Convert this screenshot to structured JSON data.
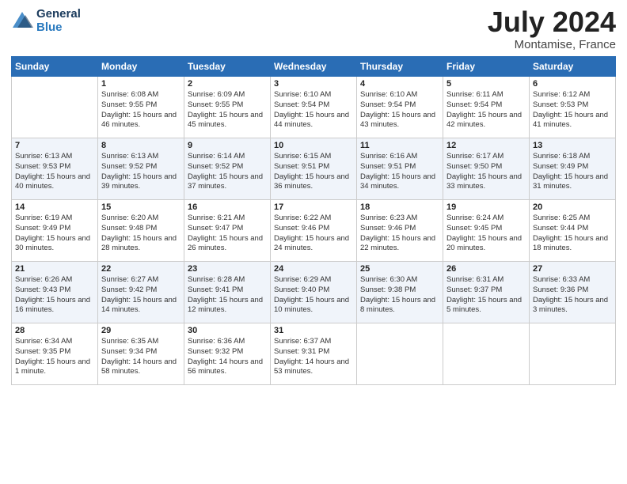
{
  "logo": {
    "line1": "General",
    "line2": "Blue"
  },
  "title": "July 2024",
  "subtitle": "Montamise, France",
  "header_days": [
    "Sunday",
    "Monday",
    "Tuesday",
    "Wednesday",
    "Thursday",
    "Friday",
    "Saturday"
  ],
  "weeks": [
    [
      {
        "day": "",
        "sunrise": "",
        "sunset": "",
        "daylight": ""
      },
      {
        "day": "1",
        "sunrise": "Sunrise: 6:08 AM",
        "sunset": "Sunset: 9:55 PM",
        "daylight": "Daylight: 15 hours and 46 minutes."
      },
      {
        "day": "2",
        "sunrise": "Sunrise: 6:09 AM",
        "sunset": "Sunset: 9:55 PM",
        "daylight": "Daylight: 15 hours and 45 minutes."
      },
      {
        "day": "3",
        "sunrise": "Sunrise: 6:10 AM",
        "sunset": "Sunset: 9:54 PM",
        "daylight": "Daylight: 15 hours and 44 minutes."
      },
      {
        "day": "4",
        "sunrise": "Sunrise: 6:10 AM",
        "sunset": "Sunset: 9:54 PM",
        "daylight": "Daylight: 15 hours and 43 minutes."
      },
      {
        "day": "5",
        "sunrise": "Sunrise: 6:11 AM",
        "sunset": "Sunset: 9:54 PM",
        "daylight": "Daylight: 15 hours and 42 minutes."
      },
      {
        "day": "6",
        "sunrise": "Sunrise: 6:12 AM",
        "sunset": "Sunset: 9:53 PM",
        "daylight": "Daylight: 15 hours and 41 minutes."
      }
    ],
    [
      {
        "day": "7",
        "sunrise": "Sunrise: 6:13 AM",
        "sunset": "Sunset: 9:53 PM",
        "daylight": "Daylight: 15 hours and 40 minutes."
      },
      {
        "day": "8",
        "sunrise": "Sunrise: 6:13 AM",
        "sunset": "Sunset: 9:52 PM",
        "daylight": "Daylight: 15 hours and 39 minutes."
      },
      {
        "day": "9",
        "sunrise": "Sunrise: 6:14 AM",
        "sunset": "Sunset: 9:52 PM",
        "daylight": "Daylight: 15 hours and 37 minutes."
      },
      {
        "day": "10",
        "sunrise": "Sunrise: 6:15 AM",
        "sunset": "Sunset: 9:51 PM",
        "daylight": "Daylight: 15 hours and 36 minutes."
      },
      {
        "day": "11",
        "sunrise": "Sunrise: 6:16 AM",
        "sunset": "Sunset: 9:51 PM",
        "daylight": "Daylight: 15 hours and 34 minutes."
      },
      {
        "day": "12",
        "sunrise": "Sunrise: 6:17 AM",
        "sunset": "Sunset: 9:50 PM",
        "daylight": "Daylight: 15 hours and 33 minutes."
      },
      {
        "day": "13",
        "sunrise": "Sunrise: 6:18 AM",
        "sunset": "Sunset: 9:49 PM",
        "daylight": "Daylight: 15 hours and 31 minutes."
      }
    ],
    [
      {
        "day": "14",
        "sunrise": "Sunrise: 6:19 AM",
        "sunset": "Sunset: 9:49 PM",
        "daylight": "Daylight: 15 hours and 30 minutes."
      },
      {
        "day": "15",
        "sunrise": "Sunrise: 6:20 AM",
        "sunset": "Sunset: 9:48 PM",
        "daylight": "Daylight: 15 hours and 28 minutes."
      },
      {
        "day": "16",
        "sunrise": "Sunrise: 6:21 AM",
        "sunset": "Sunset: 9:47 PM",
        "daylight": "Daylight: 15 hours and 26 minutes."
      },
      {
        "day": "17",
        "sunrise": "Sunrise: 6:22 AM",
        "sunset": "Sunset: 9:46 PM",
        "daylight": "Daylight: 15 hours and 24 minutes."
      },
      {
        "day": "18",
        "sunrise": "Sunrise: 6:23 AM",
        "sunset": "Sunset: 9:46 PM",
        "daylight": "Daylight: 15 hours and 22 minutes."
      },
      {
        "day": "19",
        "sunrise": "Sunrise: 6:24 AM",
        "sunset": "Sunset: 9:45 PM",
        "daylight": "Daylight: 15 hours and 20 minutes."
      },
      {
        "day": "20",
        "sunrise": "Sunrise: 6:25 AM",
        "sunset": "Sunset: 9:44 PM",
        "daylight": "Daylight: 15 hours and 18 minutes."
      }
    ],
    [
      {
        "day": "21",
        "sunrise": "Sunrise: 6:26 AM",
        "sunset": "Sunset: 9:43 PM",
        "daylight": "Daylight: 15 hours and 16 minutes."
      },
      {
        "day": "22",
        "sunrise": "Sunrise: 6:27 AM",
        "sunset": "Sunset: 9:42 PM",
        "daylight": "Daylight: 15 hours and 14 minutes."
      },
      {
        "day": "23",
        "sunrise": "Sunrise: 6:28 AM",
        "sunset": "Sunset: 9:41 PM",
        "daylight": "Daylight: 15 hours and 12 minutes."
      },
      {
        "day": "24",
        "sunrise": "Sunrise: 6:29 AM",
        "sunset": "Sunset: 9:40 PM",
        "daylight": "Daylight: 15 hours and 10 minutes."
      },
      {
        "day": "25",
        "sunrise": "Sunrise: 6:30 AM",
        "sunset": "Sunset: 9:38 PM",
        "daylight": "Daylight: 15 hours and 8 minutes."
      },
      {
        "day": "26",
        "sunrise": "Sunrise: 6:31 AM",
        "sunset": "Sunset: 9:37 PM",
        "daylight": "Daylight: 15 hours and 5 minutes."
      },
      {
        "day": "27",
        "sunrise": "Sunrise: 6:33 AM",
        "sunset": "Sunset: 9:36 PM",
        "daylight": "Daylight: 15 hours and 3 minutes."
      }
    ],
    [
      {
        "day": "28",
        "sunrise": "Sunrise: 6:34 AM",
        "sunset": "Sunset: 9:35 PM",
        "daylight": "Daylight: 15 hours and 1 minute."
      },
      {
        "day": "29",
        "sunrise": "Sunrise: 6:35 AM",
        "sunset": "Sunset: 9:34 PM",
        "daylight": "Daylight: 14 hours and 58 minutes."
      },
      {
        "day": "30",
        "sunrise": "Sunrise: 6:36 AM",
        "sunset": "Sunset: 9:32 PM",
        "daylight": "Daylight: 14 hours and 56 minutes."
      },
      {
        "day": "31",
        "sunrise": "Sunrise: 6:37 AM",
        "sunset": "Sunset: 9:31 PM",
        "daylight": "Daylight: 14 hours and 53 minutes."
      },
      {
        "day": "",
        "sunrise": "",
        "sunset": "",
        "daylight": ""
      },
      {
        "day": "",
        "sunrise": "",
        "sunset": "",
        "daylight": ""
      },
      {
        "day": "",
        "sunrise": "",
        "sunset": "",
        "daylight": ""
      }
    ]
  ]
}
